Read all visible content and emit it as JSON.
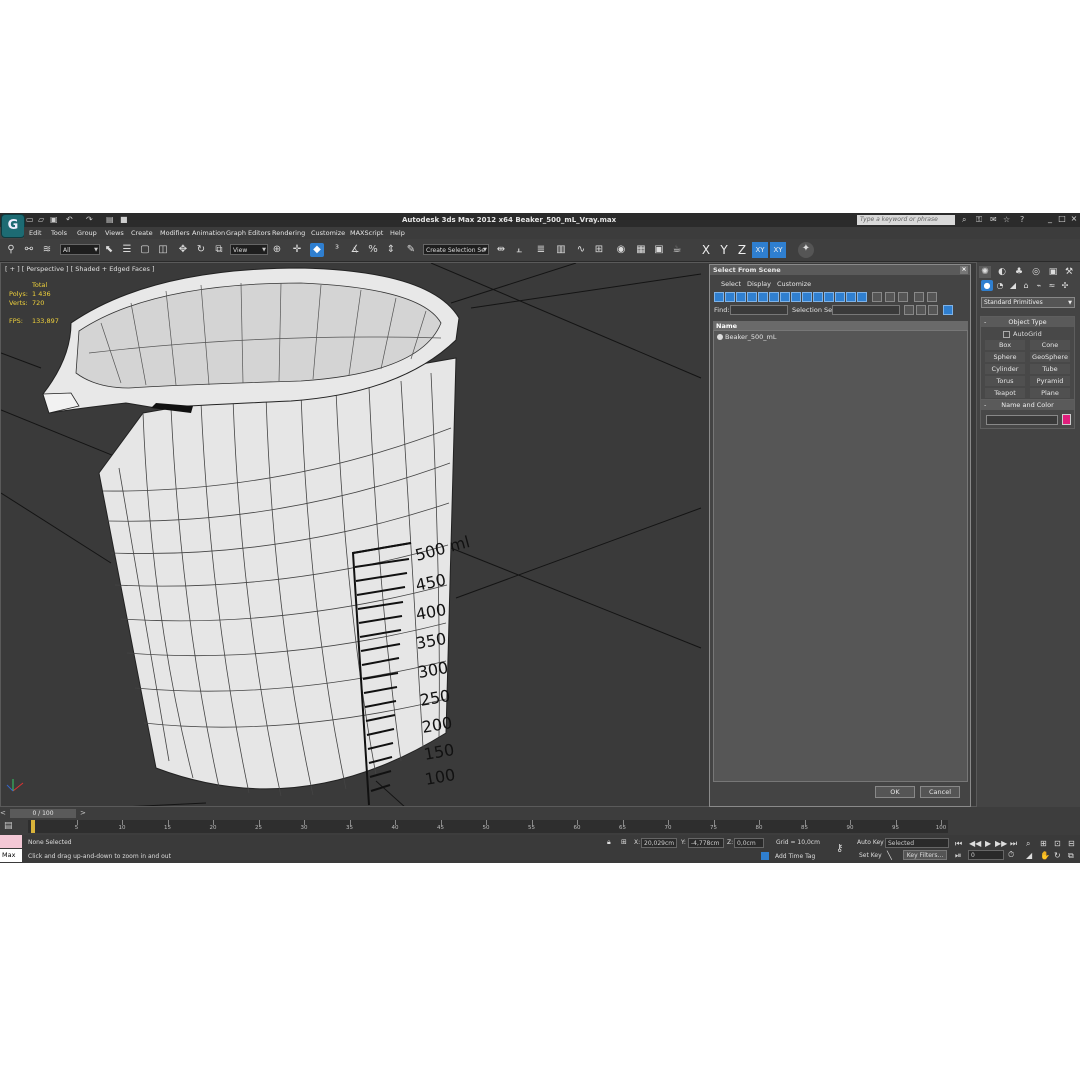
{
  "window": {
    "title": "Autodesk 3ds Max  2012 x64    Beaker_500_mL_Vray.max",
    "search_placeholder": "Type a keyword or phrase"
  },
  "menu": [
    "Edit",
    "Tools",
    "Group",
    "Views",
    "Create",
    "Modifiers",
    "Animation",
    "Graph Editors",
    "Rendering",
    "Customize",
    "MAXScript",
    "Help"
  ],
  "toolbar": {
    "selection_filter": "All",
    "reference_coord": "View",
    "selection_set": "Create Selection Se",
    "axes": [
      "X",
      "Y",
      "Z",
      "XY",
      "XY"
    ]
  },
  "viewport": {
    "label": "[ + ] [ Perspective ] [ Shaded + Edged Faces ]",
    "stats": {
      "total_label": "Total",
      "polys_label": "Polys:",
      "polys_value": "1 436",
      "verts_label": "Verts:",
      "verts_value": "720",
      "fps_label": "FPS:",
      "fps_value": "133,897"
    },
    "beaker_marks": [
      "500 ml",
      "450",
      "400",
      "350",
      "300",
      "250",
      "200",
      "150",
      "100"
    ]
  },
  "dialog": {
    "title": "Select From Scene",
    "menu": [
      "Select",
      "Display",
      "Customize"
    ],
    "find_label": "Find:",
    "selection_set_label": "Selection Set:",
    "column_header": "Name",
    "items": [
      "Beaker_500_mL"
    ],
    "ok": "OK",
    "cancel": "Cancel"
  },
  "command_panel": {
    "category": "Standard Primitives",
    "object_type_title": "Object Type",
    "autogrid": "AutoGrid",
    "primitives": [
      "Box",
      "Cone",
      "Sphere",
      "GeoSphere",
      "Cylinder",
      "Tube",
      "Torus",
      "Pyramid",
      "Teapot",
      "Plane"
    ],
    "name_color_title": "Name and Color",
    "object_color": "#e01d7c"
  },
  "timeline": {
    "frame_slider": "0 / 100",
    "ticks": [
      "5",
      "10",
      "15",
      "20",
      "25",
      "30",
      "35",
      "40",
      "45",
      "50",
      "55",
      "60",
      "65",
      "70",
      "75",
      "80",
      "85",
      "90",
      "95",
      "100"
    ]
  },
  "status": {
    "maxscript_label": "Max",
    "selection": "None Selected",
    "prompt": "Click and drag up-and-down to zoom in and out",
    "x_label": "X:",
    "x_value": "20,029cm",
    "y_label": "Y:",
    "y_value": "-4,778cm",
    "z_label": "Z:",
    "z_value": "0,0cm",
    "grid": "Grid = 10,0cm",
    "add_time_tag": "Add Time Tag",
    "auto_key": "Auto Key",
    "set_key": "Set Key",
    "key_mode": "Selected",
    "key_filters": "Key Filters...",
    "current_frame": "0"
  }
}
